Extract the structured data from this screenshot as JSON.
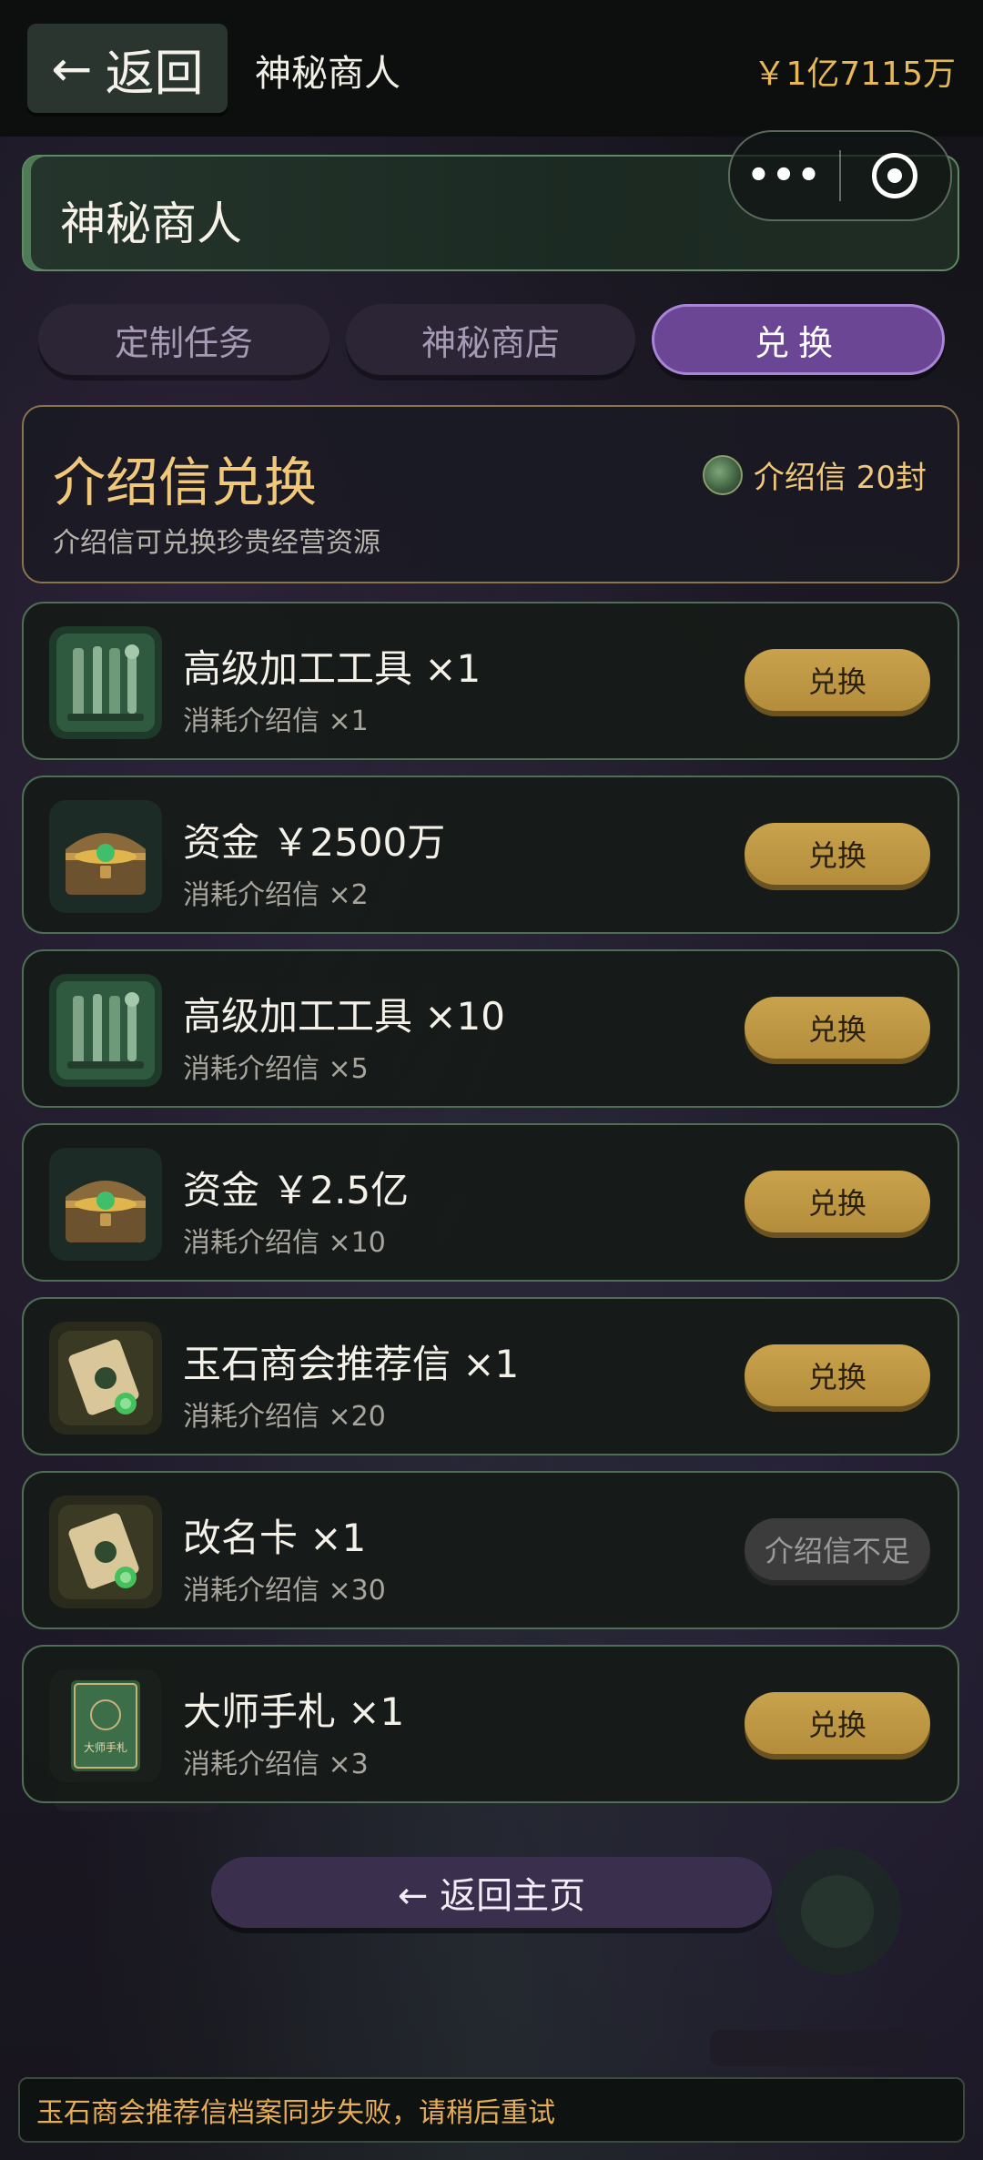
{
  "topbar": {
    "back_label": "返回",
    "title": "神秘商人",
    "money": "￥1亿7115万"
  },
  "panel": {
    "title": "神秘商人"
  },
  "tabs": [
    {
      "label": "定制任务",
      "active": false
    },
    {
      "label": "神秘商店",
      "active": false
    },
    {
      "label": "兑换",
      "active": true
    }
  ],
  "exchange": {
    "title": "介绍信兑换",
    "subtitle": "介绍信可兑换珍贵经营资源",
    "balance": "介绍信 20封"
  },
  "items": [
    {
      "name": "高级加工工具 ×1",
      "cost": "消耗介绍信 ×1",
      "button": "兑换",
      "icon": "tools-icon",
      "enabled": true
    },
    {
      "name": "资金 ￥2500万",
      "cost": "消耗介绍信 ×2",
      "button": "兑换",
      "icon": "treasure-chest-icon",
      "enabled": true
    },
    {
      "name": "高级加工工具 ×10",
      "cost": "消耗介绍信 ×5",
      "button": "兑换",
      "icon": "tools-icon",
      "enabled": true
    },
    {
      "name": "资金 ￥2.5亿",
      "cost": "消耗介绍信 ×10",
      "button": "兑换",
      "icon": "treasure-chest-icon",
      "enabled": true
    },
    {
      "name": "玉石商会推荐信 ×1",
      "cost": "消耗介绍信 ×20",
      "button": "兑换",
      "icon": "scroll-icon",
      "enabled": true
    },
    {
      "name": "改名卡 ×1",
      "cost": "消耗介绍信 ×30",
      "button": "介绍信不足",
      "icon": "scroll-icon",
      "enabled": false
    },
    {
      "name": "大师手札 ×1",
      "cost": "消耗介绍信 ×3",
      "button": "兑换",
      "icon": "book-icon",
      "enabled": true
    }
  ],
  "book_cover_text": "大师手札",
  "home_button": "← 返回主页",
  "toast": "玉石商会推荐信档案同步失败，请稍后重试",
  "colors": {
    "accent_gold": "#c8a24c",
    "money": "#e8b857",
    "active_tab": "#6a4694",
    "card_border": "#4e6e55",
    "toast_text": "#e6ad58"
  }
}
